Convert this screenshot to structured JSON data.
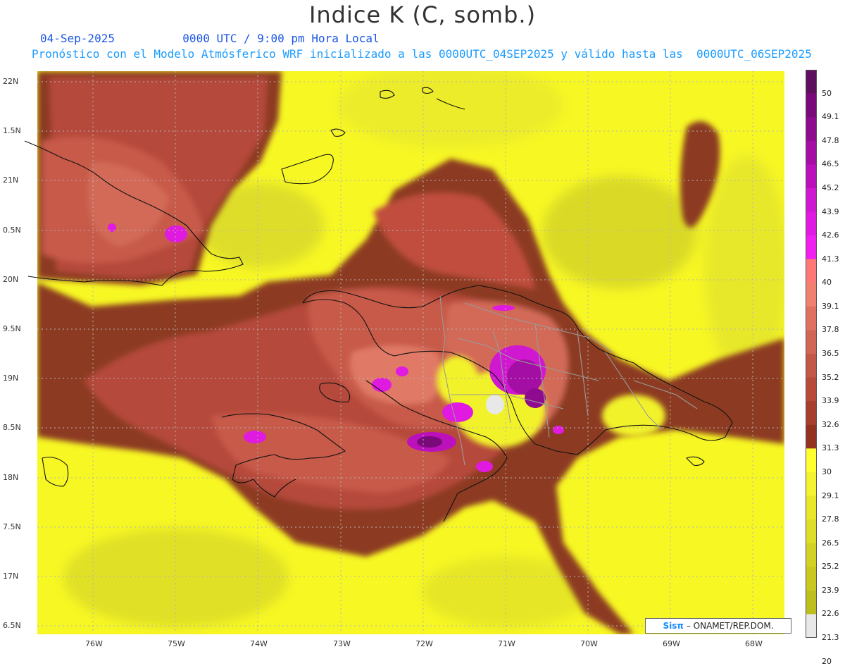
{
  "title": "Indice K (C, somb.)",
  "date": "04-Sep-2025",
  "time": "0000 UTC / 9:00 pm Hora Local",
  "forecast": "Pronóstico con el Modelo Atmósferico WRF inicializado a las 0000UTC_04SEP2025 y válido hasta las  0000UTC_06SEP2025",
  "lat_labels": [
    "22N",
    "1.5N",
    "21N",
    "0.5N",
    "20N",
    "9.5N",
    "19N",
    "8.5N",
    "18N",
    "7.5N",
    "17N",
    "6.5N"
  ],
  "lon_labels": [
    "76W",
    "75W",
    "74W",
    "73W",
    "72W",
    "71W",
    "70W",
    "69W",
    "68W"
  ],
  "legend": {
    "values": [
      "50",
      "49.1",
      "47.8",
      "46.5",
      "45.2",
      "43.9",
      "42.6",
      "41.3",
      "40",
      "39.1",
      "37.8",
      "36.5",
      "35.2",
      "33.9",
      "32.6",
      "31.3",
      "30",
      "29.1",
      "27.8",
      "26.5",
      "25.2",
      "23.9",
      "22.6",
      "21.3",
      "20"
    ],
    "colors": [
      "#5e0f5e",
      "#7a0a7a",
      "#8e0a8e",
      "#a50ea5",
      "#bb10bb",
      "#cf18cf",
      "#e01ae0",
      "#f020f0",
      "#ff7878",
      "#f08070",
      "#e07060",
      "#d26656",
      "#c45848",
      "#b84a3a",
      "#a83e2e",
      "#943222",
      "#ffff30",
      "#f3f330",
      "#e8e828",
      "#dede28",
      "#d2d224",
      "#c8c820",
      "#bebe1e",
      "#e8e8e8"
    ]
  },
  "credit": {
    "logo": "Sisπ",
    "text": "– ONAMET/REP.DOM."
  }
}
